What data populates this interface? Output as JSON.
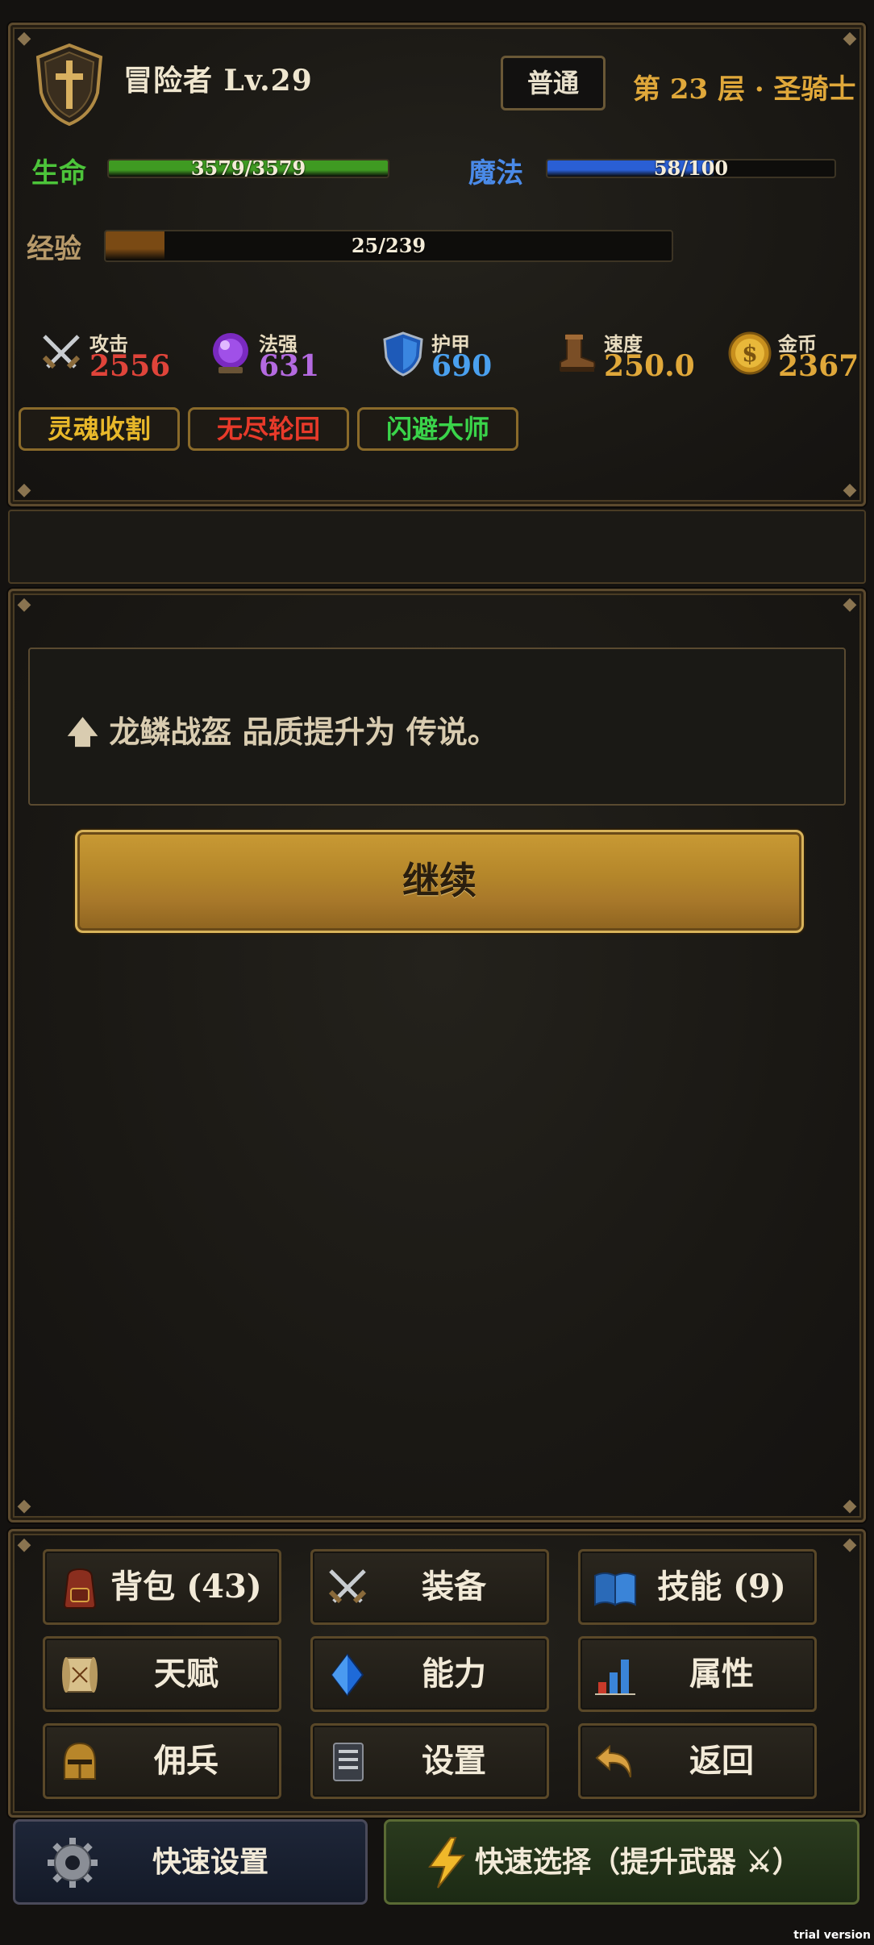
{
  "header": {
    "player_name": "冒险者 Lv.29",
    "mode": "普通",
    "floor": "第 23 层 · 圣骑士",
    "hp": {
      "label": "生命",
      "current": 3579,
      "max": 3579,
      "text": "3579/3579",
      "color": "#3f9a22"
    },
    "mp": {
      "label": "魔法",
      "current": 58,
      "max": 100,
      "text": "58/100",
      "color": "#2a5fd4"
    },
    "exp": {
      "label": "经验",
      "current": 25,
      "max": 239,
      "text": "25/239",
      "color": "#7a4a14"
    },
    "stats": [
      {
        "name": "攻击",
        "value": "2556",
        "icon": "crossed-swords-icon",
        "color": "#e0443a"
      },
      {
        "name": "法强",
        "value": "631",
        "icon": "magic-orb-icon",
        "color": "#b46ae0"
      },
      {
        "name": "护甲",
        "value": "690",
        "icon": "shield-icon",
        "color": "#4aa0ee"
      },
      {
        "name": "速度",
        "value": "250.0",
        "icon": "boot-icon",
        "color": "#e0a83a"
      },
      {
        "name": "金币",
        "value": "2367",
        "icon": "gold-coin-icon",
        "color": "#e0a83a"
      }
    ],
    "tags": [
      {
        "label": "灵魂收割",
        "color": "#e8b82a"
      },
      {
        "label": "无尽轮回",
        "color": "#e83a2a"
      },
      {
        "label": "闪避大师",
        "color": "#3ad44a"
      }
    ]
  },
  "main": {
    "message_icon": "up-arrow-icon",
    "message": "龙鳞战盔 品质提升为 传说。",
    "continue_label": "继续"
  },
  "nav": {
    "buttons": [
      {
        "label": "背包 (43)",
        "icon": "backpack-icon"
      },
      {
        "label": "装备",
        "icon": "crossed-swords-icon"
      },
      {
        "label": "技能 (9)",
        "icon": "open-book-icon"
      },
      {
        "label": "天赋",
        "icon": "scroll-icon"
      },
      {
        "label": "能力",
        "icon": "blue-crystal-icon"
      },
      {
        "label": "属性",
        "icon": "bar-chart-icon"
      },
      {
        "label": "佣兵",
        "icon": "knight-helmet-icon"
      },
      {
        "label": "设置",
        "icon": "tome-icon"
      },
      {
        "label": "返回",
        "icon": "return-arrow-icon"
      }
    ],
    "quick_settings": "快速设置",
    "quick_select": "快速选择（提升武器 ⚔）"
  },
  "watermark": "trial version"
}
